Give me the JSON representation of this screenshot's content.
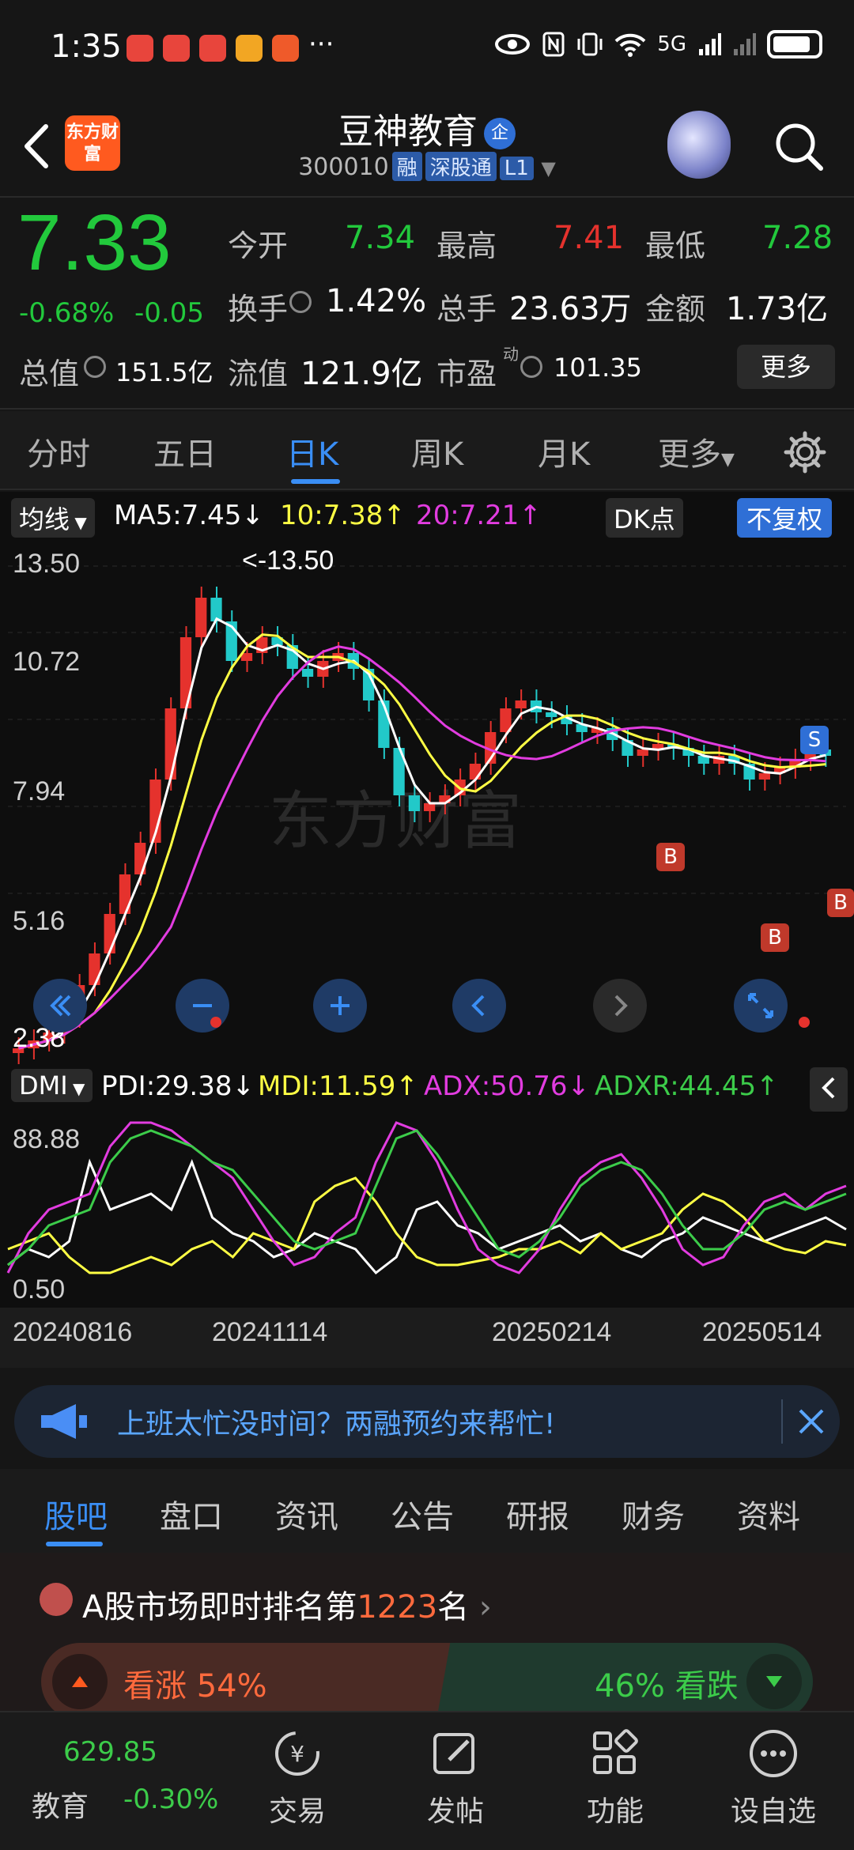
{
  "status": {
    "time": "1:35",
    "more": "···",
    "network": "5G"
  },
  "header": {
    "stock_name": "豆神教育",
    "name_badge": "企",
    "code": "300010",
    "tags": [
      "融",
      "深股通",
      "L1"
    ],
    "logo_text": "东方财富"
  },
  "quote": {
    "price": "7.33",
    "change_pct": "-0.68%",
    "change_abs": "-0.05",
    "open_label": "今开",
    "open_value": "7.34",
    "high_label": "最高",
    "high_value": "7.41",
    "low_label": "最低",
    "low_value": "7.28",
    "turnover_label": "换手",
    "turnover_value": "1.42%",
    "volume_label": "总手",
    "volume_value": "23.63万",
    "amount_label": "金额",
    "amount_value": "1.73亿",
    "mktcap_label": "总值",
    "mktcap_value": "151.5亿",
    "float_label": "流值",
    "float_value": "121.9亿",
    "pe_label": "市盈",
    "pe_sup": "动",
    "pe_value": "101.35",
    "more_label": "更多"
  },
  "period_tabs": [
    "分时",
    "五日",
    "日K",
    "周K",
    "月K",
    "更多"
  ],
  "active_period": "日K",
  "ma_row": {
    "selector": "均线",
    "ma5": "MA5:7.45↓",
    "ma10": "10:7.38↑",
    "ma20": "20:7.21↑",
    "dk": "DK点",
    "adjust": "不复权"
  },
  "price_axis": [
    "13.50",
    "10.72",
    "7.94",
    "5.16",
    "2.38"
  ],
  "annotations": {
    "high_marker": "<-13.50",
    "low_marker": "-2.38",
    "sell": "S",
    "buy": "B",
    "watermark": "东方财富"
  },
  "dmi_row": {
    "selector": "DMI",
    "pdi": "PDI:29.38↓",
    "mdi": "MDI:11.59↑",
    "adx": "ADX:50.76↓",
    "adxr": "ADXR:44.45↑"
  },
  "dmi_axis": [
    "88.88",
    "0.50"
  ],
  "date_axis": [
    "20240816",
    "20241114",
    "20250214",
    "20250514"
  ],
  "promo": {
    "text": "上班太忙没时间？两融预约来帮忙!"
  },
  "bottom_tabs": [
    "股吧",
    "盘口",
    "资讯",
    "公告",
    "研报",
    "财务",
    "资料"
  ],
  "active_bottom_tab": "股吧",
  "rank": {
    "prefix": "A股市场即时排名第",
    "number": "1223",
    "suffix": "名"
  },
  "vote": {
    "up_label": "看涨 54%",
    "down_label": "46% 看跌"
  },
  "bottom_nav": {
    "index_value": "629.85",
    "index_name": "教育",
    "index_change": "-0.30%",
    "items": [
      "交易",
      "发帖",
      "功能",
      "设自选"
    ]
  },
  "colors": {
    "up": "#e5322d",
    "down": "#22c93c",
    "accent": "#3a8ef5",
    "ma5": "#ffffff",
    "ma10": "#ffff44",
    "ma20": "#e23ce0"
  }
}
